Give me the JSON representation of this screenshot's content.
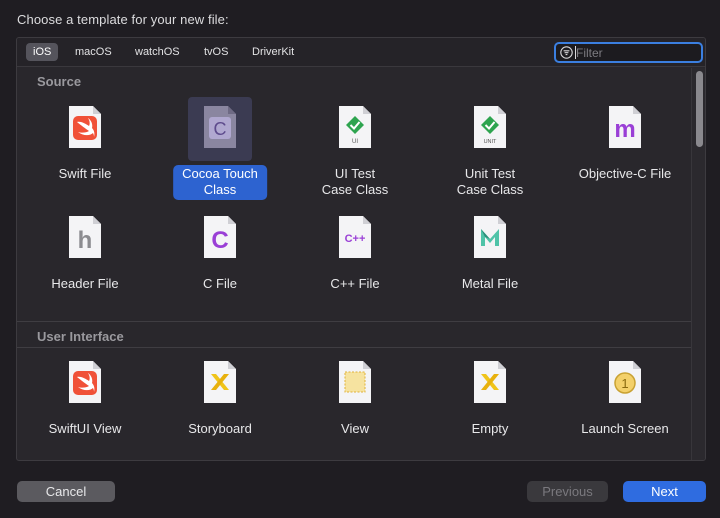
{
  "dialog": {
    "title": "Choose a template for your new file:"
  },
  "platform_tabs": [
    {
      "label": "iOS",
      "selected": true
    },
    {
      "label": "macOS",
      "selected": false
    },
    {
      "label": "watchOS",
      "selected": false
    },
    {
      "label": "tvOS",
      "selected": false
    },
    {
      "label": "DriverKit",
      "selected": false
    }
  ],
  "filter": {
    "placeholder": "Filter",
    "value": ""
  },
  "sections": [
    {
      "title": "Source",
      "items": [
        {
          "label": "Swift File",
          "icon": "swift-file-icon"
        },
        {
          "label": "Cocoa Touch\nClass",
          "icon": "cocoa-touch-class-icon",
          "selected": true
        },
        {
          "label": "UI Test\nCase Class",
          "icon": "ui-test-case-icon",
          "badge": "UI"
        },
        {
          "label": "Unit Test\nCase Class",
          "icon": "unit-test-case-icon",
          "badge": "UNIT"
        },
        {
          "label": "Objective-C File",
          "icon": "objective-c-file-icon",
          "glyph": "m"
        },
        {
          "label": "Header File",
          "icon": "header-file-icon",
          "glyph": "h"
        },
        {
          "label": "C File",
          "icon": "c-file-icon",
          "glyph": "C"
        },
        {
          "label": "C++ File",
          "icon": "cpp-file-icon",
          "glyph": "C++"
        },
        {
          "label": "Metal File",
          "icon": "metal-file-icon"
        }
      ]
    },
    {
      "title": "User Interface",
      "items": [
        {
          "label": "SwiftUI View",
          "icon": "swiftui-view-icon"
        },
        {
          "label": "Storyboard",
          "icon": "storyboard-icon"
        },
        {
          "label": "View",
          "icon": "view-icon"
        },
        {
          "label": "Empty",
          "icon": "empty-icon"
        },
        {
          "label": "Launch Screen",
          "icon": "launch-screen-icon",
          "glyph": "1"
        }
      ]
    }
  ],
  "buttons": {
    "cancel": "Cancel",
    "previous": "Previous",
    "next": "Next"
  },
  "colors": {
    "accent": "#2f6ce0",
    "selection": "#2d63d0",
    "swift": "#f05138",
    "objc_purple": "#9a3fd6",
    "test_green": "#2ea44f",
    "metal_teal": "#4fc3a8",
    "storyboard_yellow": "#f0c419"
  }
}
